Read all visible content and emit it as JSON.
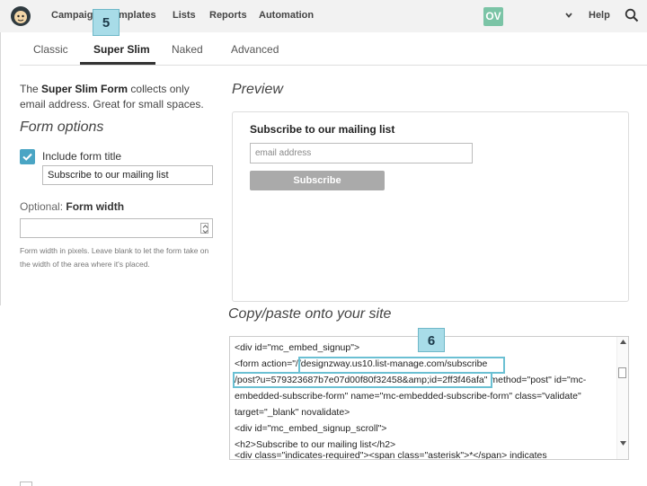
{
  "nav": {
    "items": [
      "Campaigns",
      "Templates",
      "Lists",
      "Reports",
      "Automation"
    ],
    "avatar_initials": "OV",
    "help": "Help"
  },
  "badges": {
    "step5": "5",
    "step6": "6"
  },
  "tabs": [
    "Classic",
    "Super Slim",
    "Naked",
    "Advanced"
  ],
  "description": {
    "prefix": "The",
    "form_name": "Super Slim Form",
    "suffix": "collects only email address. Great for small spaces."
  },
  "form_options": {
    "heading": "Form options",
    "include_title_label": "Include form title",
    "include_title_checked": true,
    "title_value": "Subscribe to our mailing list",
    "width_optional": "Optional:",
    "width_label": "Form width",
    "width_value": "",
    "width_help": "Form width in pixels. Leave blank to let the form take on the width of the area where it's placed."
  },
  "preview": {
    "heading": "Preview",
    "form_title": "Subscribe to our mailing list",
    "email_placeholder": "email address",
    "button_label": "Subscribe"
  },
  "code": {
    "heading": "Copy/paste onto your site",
    "lines": [
      "<div id=\"mc_embed_signup\">",
      "<form action=\"//designzway.us10.list-manage.com/subscribe",
      "/post?u=579323687b7e07d00f80f32458&amp;id=2ff3f46afa\" method=\"post\" id=\"mc-",
      "embedded-subscribe-form\" name=\"mc-embedded-subscribe-form\" class=\"validate\"",
      "target=\"_blank\" novalidate>",
      "    <div id=\"mc_embed_signup_scroll\">",
      "        <h2>Subscribe to our mailing list</h2>",
      "<div class=\"indicates-required\"><span class=\"asterisk\">*</span> indicates"
    ]
  },
  "colors": {
    "accent": "#4aa5c4",
    "badge": "#a8dce8",
    "avatar": "#7bc4a6",
    "highlight": "#6bc0d3"
  }
}
